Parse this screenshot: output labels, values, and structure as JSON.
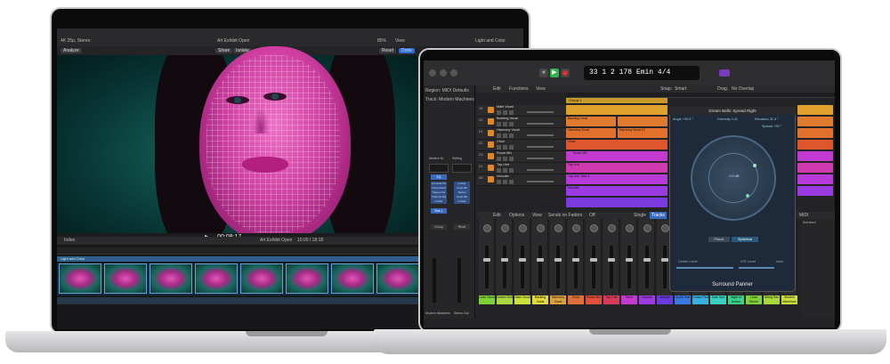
{
  "fcp": {
    "window": {
      "format": "4K 25p, Stereo",
      "project_title": "Art Exhibit Open",
      "zoom": "85%",
      "view_label": "View",
      "right_panel_title": "Light and Color"
    },
    "viewer_controls": {
      "analysis_label": "Analyze",
      "share_label": "Share",
      "isolate_label": "Isolate",
      "reset_label": "Reset",
      "done_label": "Done",
      "timecode": "00:08:17"
    },
    "timeline": {
      "index_label": "Index",
      "project_name": "Art Exhibit Open",
      "duration": "10:00 / 18:18",
      "clip_label": "Light and Color"
    }
  },
  "logic": {
    "toolbar": {
      "lcd_bar": "33",
      "lcd_beat": "1",
      "lcd_div": "2",
      "lcd_tick": "178",
      "lcd_key": "Emin",
      "lcd_pos": "4",
      "lcd_sig": "4"
    },
    "inspector": {
      "region_label": "Region: MIDI Defaults",
      "track_label": "Track: Modern Machines",
      "strip1_name": "Modern M.",
      "strip2_name": "Setting",
      "eq_label": "EQ",
      "plugins": [
        "Console Ch",
        "Compressor",
        "Stereo Out",
        "Channel EQ",
        "Limiter"
      ],
      "plugins_r": [
        "Limiter",
        "Level Mtr",
        "Stereo",
        "Level Mtr",
        "Limiter"
      ],
      "bus_label": "Bus 1",
      "group_label": "Group",
      "read_label": "Read",
      "footer_name": "Modern Machines",
      "footer_name2": "Stereo Out"
    },
    "tracks_bar": {
      "edit": "Edit",
      "functions": "Functions",
      "view": "View",
      "snap": "Snap:",
      "snap_val": "Smart",
      "drag": "Drag:",
      "drag_val": "No Overlap"
    },
    "tracks": [
      {
        "num": "19",
        "name": "Main Vocal"
      },
      {
        "num": "20",
        "name": "Backing Vocal"
      },
      {
        "num": "21",
        "name": "Harmony Vocal"
      },
      {
        "num": "22",
        "name": "Choir"
      },
      {
        "num": "23",
        "name": "Room Mix"
      },
      {
        "num": "24",
        "name": "Top Line"
      },
      {
        "num": "25",
        "name": "Vocoder"
      }
    ],
    "regions": [
      "Chorus 1",
      "Backing Vocal",
      "Harmony Vocal",
      "Harmony Vocal 10",
      "Choir",
      "Room Mix",
      "Top Line",
      "Top Line Take 4",
      "Vocoder"
    ],
    "mixer_bar": {
      "edit": "Edit",
      "options": "Options",
      "view": "View",
      "sends": "Sends on Faders",
      "off": "Off",
      "single": "Single",
      "tracks": "Tracks"
    },
    "channel_labels": [
      "Lead Vocal",
      "Dream Surf",
      "Main Vocal",
      "Backing Vocal",
      "Harmony Vocal",
      "Choir",
      "Room Mix",
      "Top Line",
      "Tenor",
      "Vocoder",
      "Sample",
      "Synth Pad",
      "Canon Pad",
      "Dark Surf",
      "Night of Action",
      "Lead Remix",
      "String Sec",
      "Modern Machines"
    ],
    "channel_colors": [
      "#7fd13a",
      "#a8d83b",
      "#cbe03d",
      "#e0d83d",
      "#d9a23c",
      "#e0703a",
      "#e0503a",
      "#d83a5a",
      "#c23ad0",
      "#9a3ae0",
      "#6a3ae0",
      "#3a7ae0",
      "#3ab0e0",
      "#3ad0c0",
      "#3ad08a",
      "#7fd13a",
      "#a8d83b",
      "#cbe03d"
    ],
    "panner": {
      "title": "Dream Bells: Spread Right",
      "angle_label": "Angle",
      "angle_val": "+59.5 °",
      "diversity_label": "Diversity",
      "diversity_val": "0.41",
      "elevation_label": "Elevation",
      "elevation_val": "31.5 °",
      "spread_label": "Spread",
      "spread_val": "+90 °",
      "center_db": "0.0 dB",
      "planar_label": "Planar",
      "spherical_label": "Spherical",
      "center_level_label": "Center Level",
      "lfe_level_label": "LFE Level",
      "mute_label": "mute",
      "footer_title": "Surround Panner"
    },
    "right_strip": {
      "midi_label": "MIDI",
      "surround_label": "Surround"
    }
  },
  "icons": [
    "play-icon",
    "record-icon",
    "rewind-icon",
    "forward-icon",
    "cycle-icon",
    "speaker-icon",
    "headphones-icon",
    "lock-icon",
    "settings-icon"
  ]
}
